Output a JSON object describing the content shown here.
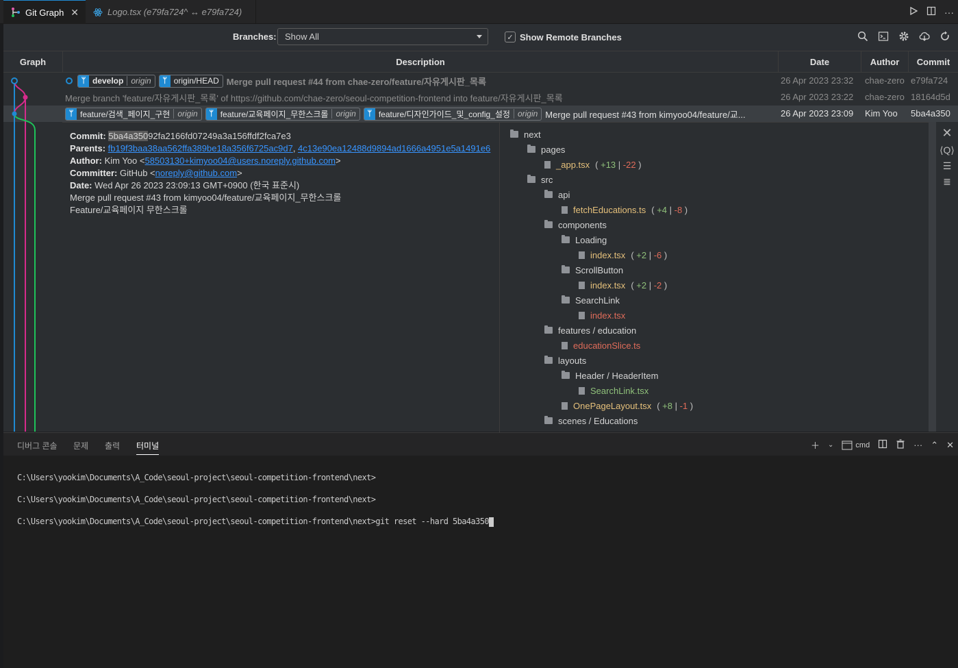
{
  "tabs": [
    {
      "label": "Git Graph",
      "active": true
    },
    {
      "label": "Logo.tsx (e79fa724^ ↔ e79fa724)",
      "active": false
    }
  ],
  "controls": {
    "branches_label": "Branches:",
    "branches_value": "Show All",
    "remote_label": "Show Remote Branches",
    "remote_checked": true
  },
  "columns": {
    "graph": "Graph",
    "description": "Description",
    "date": "Date",
    "author": "Author",
    "commit": "Commit"
  },
  "commits": [
    {
      "refs": [
        {
          "name": "develop",
          "remote": "origin",
          "bold": true
        },
        {
          "name": "origin/HEAD",
          "remote": ""
        }
      ],
      "message": "Merge pull request #44 from chae-zero/feature/자유게시판_목록",
      "date": "26 Apr 2023 23:32",
      "author": "chae-zero",
      "hash": "e79fa724"
    },
    {
      "refs": [],
      "message": "Merge branch 'feature/자유게시판_목록' of https://github.com/chae-zero/seoul-competition-frontend into feature/자유게시판_목록",
      "date": "26 Apr 2023 23:22",
      "author": "chae-zero",
      "hash": "18164d5d"
    },
    {
      "refs": [
        {
          "name": "feature/검색_페이지_구현",
          "remote": "origin"
        },
        {
          "name": "feature/교육페이지_무한스크롤",
          "remote": "origin"
        },
        {
          "name": "feature/디자인가이드_및_config_설정",
          "remote": "origin"
        }
      ],
      "message": "Merge pull request #43 from kimyoo04/feature/교...",
      "date": "26 Apr 2023 23:09",
      "author": "Kim Yoo",
      "hash": "5ba4a350"
    }
  ],
  "details": {
    "commit_label": "Commit:",
    "commit_hash_highlight": "5ba4a350",
    "commit_hash_rest": "92fa2166fd07249a3a156ffdf2fca7e3",
    "parents_label": "Parents:",
    "parent1": "fb19f3baa38aa562ffa389be18a356f6725ac9d7",
    "parent2": "4c13e90ea12488d9894ad1666a4951e5a1491e6",
    "author_label": "Author:",
    "author_name": "Kim Yoo <",
    "author_email": "58503130+kimyoo04@users.noreply.github.com",
    "committer_label": "Committer:",
    "committer_name": "GitHub <",
    "committer_email": "noreply@github.com",
    "date_label": "Date:",
    "date_value": "Wed Apr 26 2023 23:09:13 GMT+0900 (한국 표준시)",
    "message1": "Merge pull request #43 from kimyoo04/feature/교육페이지_무한스크롤",
    "message2": "Feature/교육페이지 무한스크롤"
  },
  "file_tree": [
    {
      "depth": 0,
      "type": "folder",
      "name": "next"
    },
    {
      "depth": 1,
      "type": "folder",
      "name": "pages"
    },
    {
      "depth": 2,
      "type": "file",
      "name": "_app.tsx",
      "status": "mod",
      "add": "+13",
      "del": "-22"
    },
    {
      "depth": 1,
      "type": "folder",
      "name": "src"
    },
    {
      "depth": 2,
      "type": "folder",
      "name": "api"
    },
    {
      "depth": 3,
      "type": "file",
      "name": "fetchEducations.ts",
      "status": "mod",
      "add": "+4",
      "del": "-8"
    },
    {
      "depth": 2,
      "type": "folder",
      "name": "components"
    },
    {
      "depth": 3,
      "type": "folder",
      "name": "Loading"
    },
    {
      "depth": 4,
      "type": "file",
      "name": "index.tsx",
      "status": "mod",
      "add": "+2",
      "del": "-6"
    },
    {
      "depth": 3,
      "type": "folder",
      "name": "ScrollButton"
    },
    {
      "depth": 4,
      "type": "file",
      "name": "index.tsx",
      "status": "mod",
      "add": "+2",
      "del": "-2"
    },
    {
      "depth": 3,
      "type": "folder",
      "name": "SearchLink"
    },
    {
      "depth": 4,
      "type": "file",
      "name": "index.tsx",
      "status": "del"
    },
    {
      "depth": 2,
      "type": "folder",
      "name": "features / education"
    },
    {
      "depth": 3,
      "type": "file",
      "name": "educationSlice.ts",
      "status": "del"
    },
    {
      "depth": 2,
      "type": "folder",
      "name": "layouts"
    },
    {
      "depth": 3,
      "type": "folder",
      "name": "Header / HeaderItem"
    },
    {
      "depth": 4,
      "type": "file",
      "name": "SearchLink.tsx",
      "status": "add"
    },
    {
      "depth": 3,
      "type": "file",
      "name": "OnePageLayout.tsx",
      "status": "mod",
      "add": "+8",
      "del": "-1"
    },
    {
      "depth": 2,
      "type": "folder",
      "name": "scenes / Educations"
    }
  ],
  "panel": {
    "tabs": [
      "디버그 콘솔",
      "문제",
      "출력",
      "터미널"
    ],
    "active_tab": "터미널",
    "shell": "cmd"
  },
  "terminal_lines": [
    "C:\\Users\\yookim\\Documents\\A_Code\\seoul-project\\seoul-competition-frontend\\next>",
    "C:\\Users\\yookim\\Documents\\A_Code\\seoul-project\\seoul-competition-frontend\\next>",
    "C:\\Users\\yookim\\Documents\\A_Code\\seoul-project\\seoul-competition-frontend\\next>git reset --hard 5ba4a350"
  ],
  "colors": {
    "accent": "#1f8ad2",
    "graph_blue": "#1f8ad2",
    "graph_pink": "#d62b8c",
    "graph_green": "#1ec35a",
    "link": "#3794ff"
  }
}
